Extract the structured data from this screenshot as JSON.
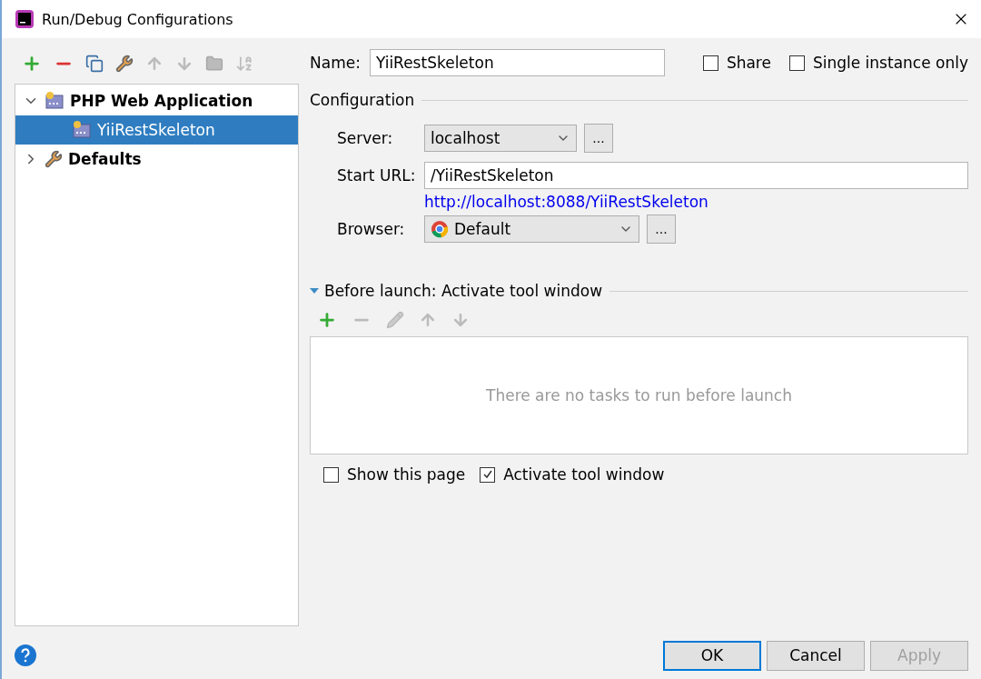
{
  "window": {
    "title": "Run/Debug Configurations"
  },
  "tree": [
    {
      "label": "PHP Web Application",
      "kind": "php",
      "expanded": true,
      "selected": false,
      "children": [
        {
          "label": "YiiRestSkeleton",
          "kind": "php",
          "selected": true
        }
      ]
    },
    {
      "label": "Defaults",
      "kind": "wrench",
      "expanded": false,
      "selected": false
    }
  ],
  "name": {
    "label": "Name:",
    "value": "YiiRestSkeleton"
  },
  "options": [
    {
      "label": "Share",
      "checked": false
    },
    {
      "label": "Single instance only",
      "checked": false
    }
  ],
  "configuration": {
    "title": "Configuration",
    "server": {
      "label": "Server:",
      "value": "localhost",
      "more": "..."
    },
    "start_url": {
      "label": "Start URL:",
      "value": "/YiiRestSkeleton"
    },
    "link": "http://localhost:8088/YiiRestSkeleton",
    "browser": {
      "label": "Browser:",
      "value": "Default",
      "more": "..."
    }
  },
  "before_launch": {
    "title": "Before launch: Activate tool window",
    "expanded": true,
    "empty_text": "There are no tasks to run before launch"
  },
  "launch_options": [
    {
      "label": "Show this page",
      "checked": false
    },
    {
      "label": "Activate tool window",
      "checked": true
    }
  ],
  "buttons": [
    {
      "label": "OK",
      "default": true,
      "disabled": false
    },
    {
      "label": "Cancel",
      "default": false,
      "disabled": false
    },
    {
      "label": "Apply",
      "default": false,
      "disabled": true
    }
  ]
}
